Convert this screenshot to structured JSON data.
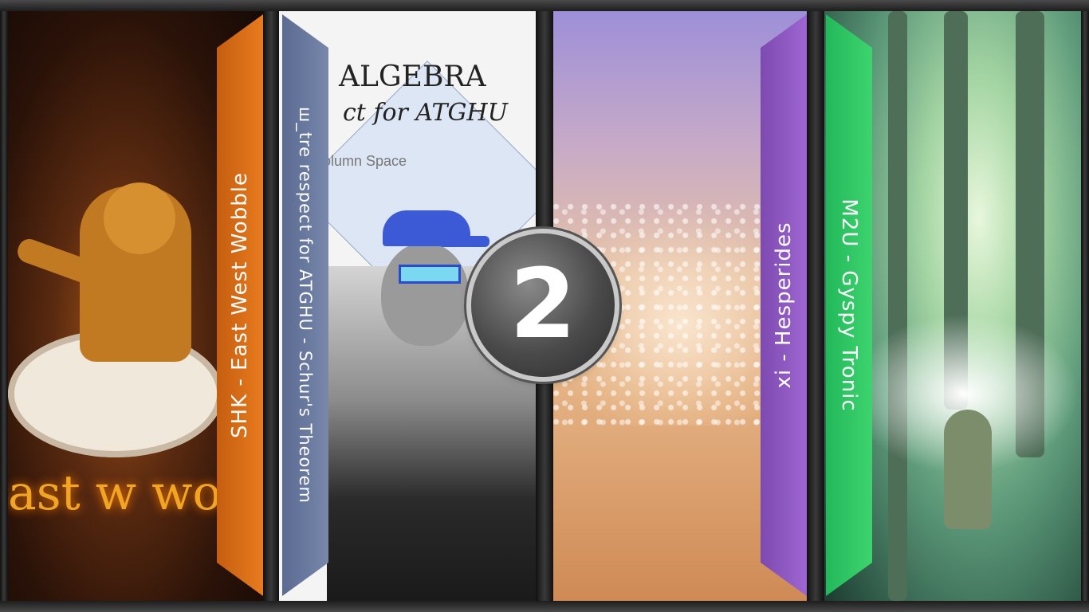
{
  "panels": [
    {
      "label": "SHK - East West Wobble",
      "accent": "#e06f1a"
    },
    {
      "label": "ш_tre respect for ATGHU - Schur's Theorem",
      "accent": "#6b7aa0"
    },
    {
      "label": "xi - Hesperides",
      "accent": "#8f5ac4"
    },
    {
      "label": "M2U - Gyspy Tronic",
      "accent": "#30c866"
    }
  ],
  "badge": {
    "number": "2"
  },
  "art": {
    "panel1_text": "ast w wo",
    "panel2_title": "ALGEBRA",
    "panel2_subtitle": "ct for ATGHU",
    "panel2_caption": "olumn Space"
  }
}
